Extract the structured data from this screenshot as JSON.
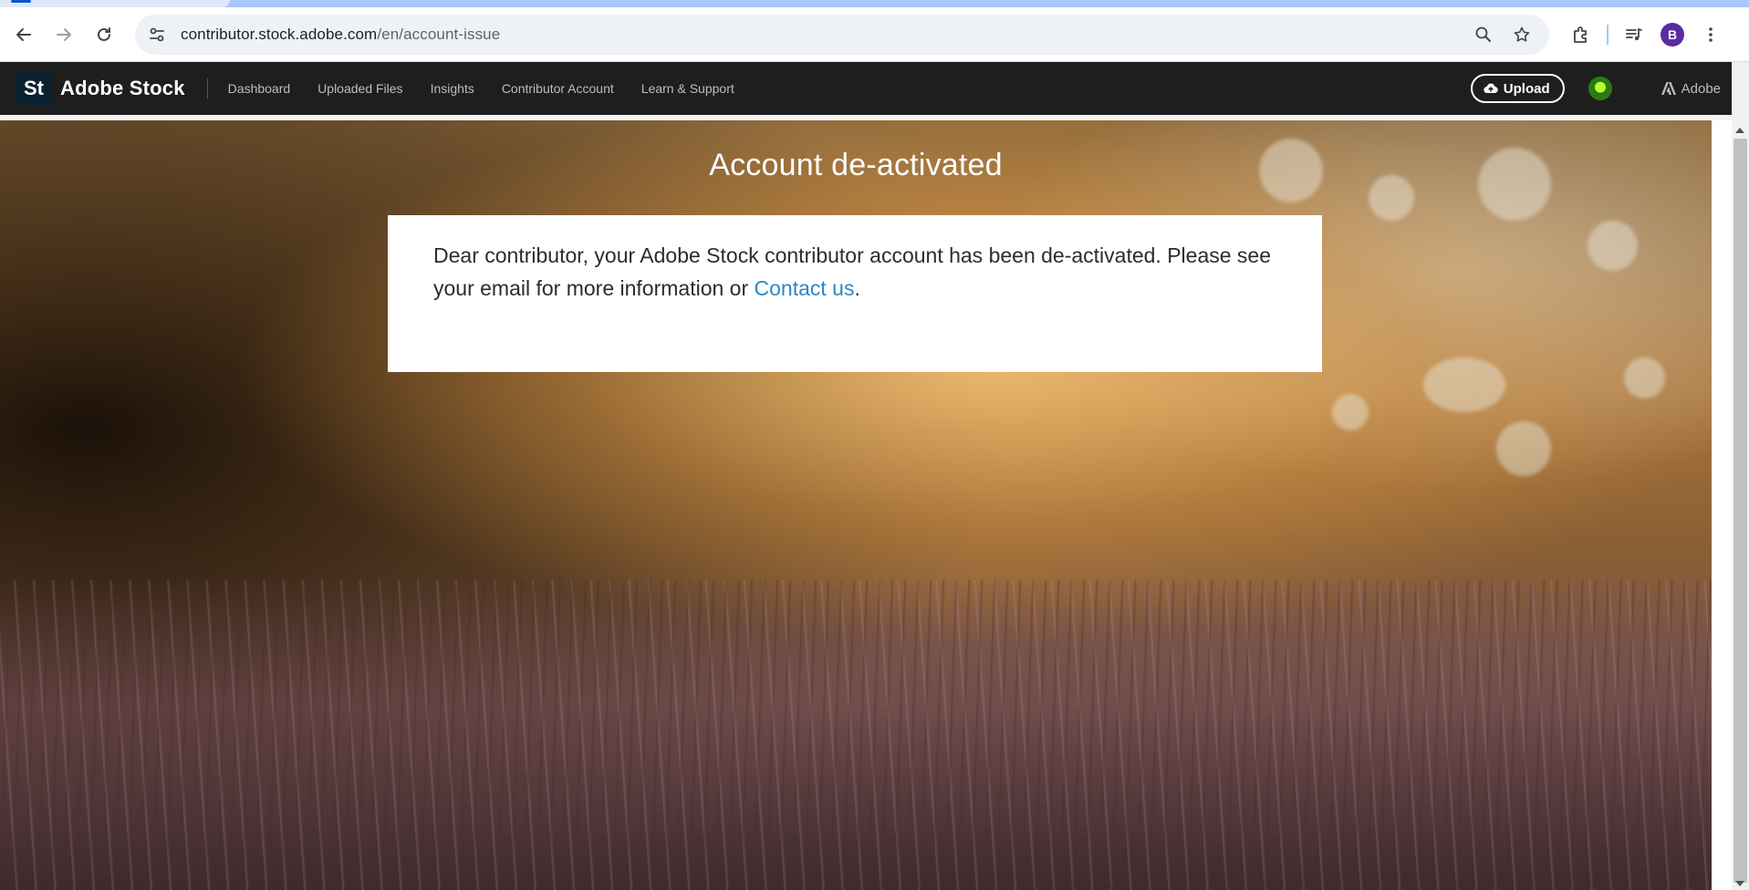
{
  "browser": {
    "url_host": "contributor.stock.adobe.com",
    "url_path": "/en/account-issue",
    "profile_initial": "B",
    "icons": [
      "back-arrow-icon",
      "forward-arrow-icon",
      "reload-icon",
      "site-settings-icon",
      "zoom-icon",
      "bookmark-star-icon",
      "extensions-icon",
      "media-controls-icon",
      "kebab-menu-icon"
    ]
  },
  "header": {
    "logo_text": "St",
    "brand": "Adobe Stock",
    "nav": [
      {
        "label": "Dashboard"
      },
      {
        "label": "Uploaded Files"
      },
      {
        "label": "Insights"
      },
      {
        "label": "Contributor Account"
      },
      {
        "label": "Learn & Support"
      }
    ],
    "upload_label": "Upload",
    "adobe_label": "Adobe"
  },
  "main": {
    "title": "Account de-activated",
    "message_before": "Dear contributor, your Adobe Stock contributor account has been de-activated. Please see your email for more information or ",
    "contact_link": "Contact us",
    "message_after": "."
  },
  "colors": {
    "header_bg": "#1e1e1e",
    "link": "#2d86c4",
    "logo_bg": "#0a2130",
    "profile_bg": "#5b2ca0"
  }
}
